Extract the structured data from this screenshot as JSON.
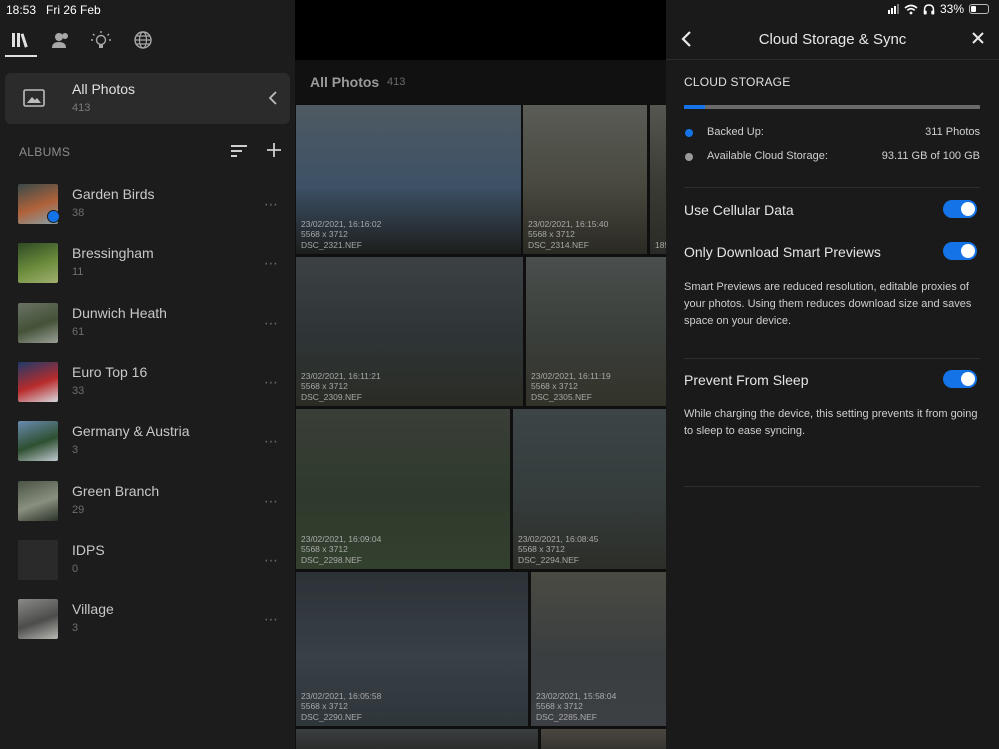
{
  "status": {
    "time": "18:53",
    "date": "Fri 26 Feb",
    "battery": "33%",
    "battery_level": 0.33
  },
  "sidebar": {
    "nav": [
      {
        "icon": "library-icon"
      },
      {
        "icon": "people-icon"
      },
      {
        "icon": "learn-lightbulb-icon"
      },
      {
        "icon": "discover-globe-icon"
      }
    ],
    "all_photos": {
      "title": "All Photos",
      "count": "413"
    },
    "albums_heading": "ALBUMS",
    "albums": [
      {
        "name": "Garden Birds",
        "count": "38",
        "synced": true,
        "colors": [
          "#3a4a4a",
          "#b0623a",
          "#88a0a8"
        ]
      },
      {
        "name": "Bressingham",
        "count": "11",
        "colors": [
          "#2e4a24",
          "#6c8c3c",
          "#a0b070"
        ]
      },
      {
        "name": "Dunwich Heath",
        "count": "61",
        "colors": [
          "#6a7264",
          "#445238",
          "#9aa096"
        ]
      },
      {
        "name": "Euro Top 16",
        "count": "33",
        "colors": [
          "#1e3a6a",
          "#b82c2c",
          "#d8d8e0"
        ]
      },
      {
        "name": "Germany & Austria",
        "count": "3",
        "colors": [
          "#6a8ab0",
          "#2e5030",
          "#c0c8d0"
        ]
      },
      {
        "name": "Green Branch",
        "count": "29",
        "colors": [
          "#4a5444",
          "#8a9080",
          "#2a3228"
        ]
      },
      {
        "name": "IDPS",
        "count": "0",
        "colors": [
          "#2a2a2a",
          "#2a2a2a",
          "#2a2a2a"
        ]
      },
      {
        "name": "Village",
        "count": "3",
        "colors": [
          "#8a8a88",
          "#4c4c4a",
          "#b8b8b4"
        ]
      }
    ]
  },
  "grid": {
    "title": "All Photos",
    "count": "413",
    "photos": [
      {
        "date": "23/02/2021, 16:16:02",
        "dims": "5568 x 3712",
        "file": "DSC_2321.NEF",
        "colors": [
          "#4e5a62",
          "#3d5066",
          "#1c1e1c"
        ]
      },
      {
        "date": "23/02/2021, 16:15:40",
        "dims": "5568 x 3712",
        "file": "DSC_2314.NEF",
        "colors": [
          "#5a5c56",
          "#48483e",
          "#2a2a24"
        ]
      },
      {
        "date": "",
        "dims": "185",
        "file": "",
        "colors": [
          "#555650",
          "#3a3a34",
          "#2a2a26"
        ]
      },
      {
        "date": "23/02/2021, 16:11:21",
        "dims": "5568 x 3712",
        "file": "DSC_2309.NEF",
        "colors": [
          "#3c4244",
          "#2e3436",
          "#2a2c24"
        ]
      },
      {
        "date": "23/02/2021, 16:11:19",
        "dims": "5568 x 3712",
        "file": "DSC_2305.NEF",
        "colors": [
          "#4a4e4c",
          "#3a3e3a",
          "#323228"
        ]
      },
      {
        "date": "23/02/2021, 16:09:04",
        "dims": "5568 x 3712",
        "file": "DSC_2298.NEF",
        "colors": [
          "#3a3e38",
          "#2e3a2c",
          "#33402e"
        ]
      },
      {
        "date": "23/02/2021, 16:08:45",
        "dims": "5568 x 3712",
        "file": "DSC_2294.NEF",
        "colors": [
          "#3c4446",
          "#353c3c",
          "#2c2e28"
        ]
      },
      {
        "date": "23/02/2021, 16:05:58",
        "dims": "5568 x 3712",
        "file": "DSC_2290.NEF",
        "colors": [
          "#2c3236",
          "#384048",
          "#2e363a"
        ]
      },
      {
        "date": "23/02/2021, 15:58:04",
        "dims": "5568 x 3712",
        "file": "DSC_2285.NEF",
        "colors": [
          "#4a4a42",
          "#3a3e40",
          "#3c4044"
        ]
      },
      {
        "date": "",
        "dims": "",
        "file": "",
        "colors": [
          "#3a3e3e",
          "#2e3030",
          "#262826"
        ]
      },
      {
        "date": "",
        "dims": "",
        "file": "",
        "colors": [
          "#4a4640",
          "#3a3834",
          "#2a2826"
        ]
      },
      {
        "date": "",
        "dims": "",
        "file": "",
        "colors": [
          "#3a4040",
          "#2e3434",
          "#262a2a"
        ]
      }
    ]
  },
  "panel": {
    "title": "Cloud Storage & Sync",
    "section": "CLOUD STORAGE",
    "backup_fraction": 0.07,
    "backed_up_label": "Backed Up:",
    "backed_up_value": "311 Photos",
    "available_label": "Available Cloud Storage:",
    "available_value": "93.11 GB of 100 GB",
    "cellular_label": "Use Cellular Data",
    "cellular_on": true,
    "smart_label": "Only Download Smart Previews",
    "smart_on": true,
    "smart_desc": "Smart Previews are reduced resolution, editable proxies of your photos. Using them reduces download size and saves space on your device.",
    "sleep_label": "Prevent From Sleep",
    "sleep_on": true,
    "sleep_desc": "While charging the device, this setting prevents it from going to sleep to ease syncing.",
    "colors": {
      "accent": "#1473e6",
      "available": "#9a9a9a"
    }
  }
}
